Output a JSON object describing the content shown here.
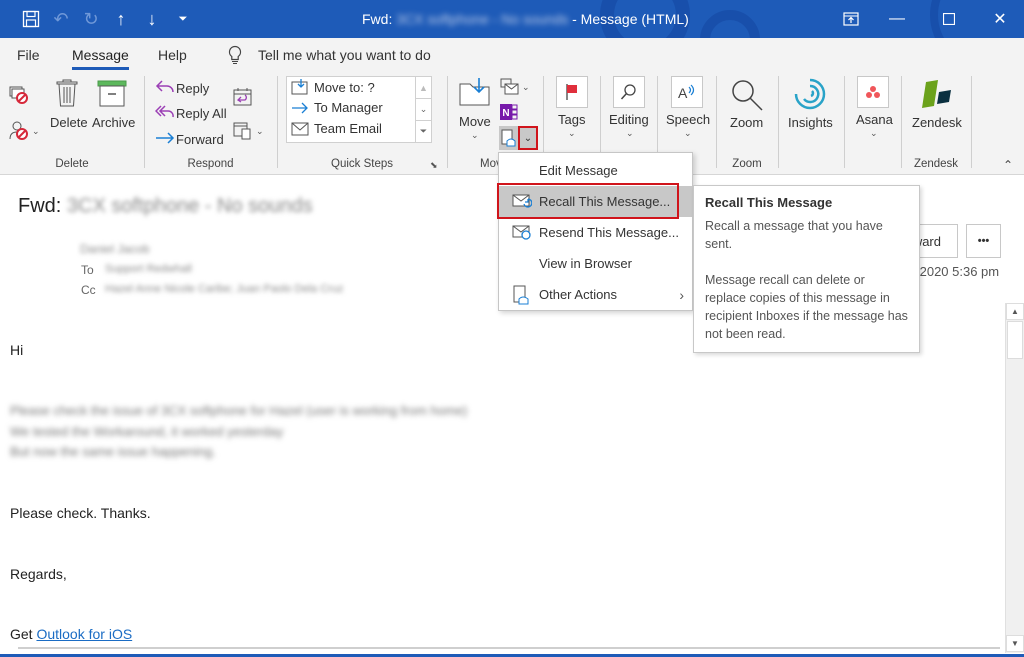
{
  "titlebar": {
    "subject_prefix": "Fwd:",
    "subject_blurred": "3CX softphone - No sounds",
    "suffix": "- Message (HTML)",
    "quick_access": [
      {
        "name": "save-icon",
        "glyph": "🖫"
      },
      {
        "name": "undo-icon",
        "glyph": "↶"
      },
      {
        "name": "redo-icon",
        "glyph": "↻"
      },
      {
        "name": "previous-item-icon",
        "glyph": "↑"
      },
      {
        "name": "next-item-icon",
        "glyph": "↓"
      },
      {
        "name": "customize-qat-icon",
        "glyph": "⏷"
      }
    ],
    "window_buttons": {
      "ribbon_display": "⊡",
      "minimize": "—",
      "maximize": "☐",
      "close": "✕"
    }
  },
  "tabs": {
    "file": "File",
    "message": "Message",
    "help": "Help",
    "tell_me": "Tell me what you want to do"
  },
  "ribbon": {
    "delete_group": {
      "label": "Delete",
      "delete": "Delete",
      "archive": "Archive"
    },
    "respond_group": {
      "label": "Respond",
      "reply": "Reply",
      "reply_all": "Reply All",
      "forward": "Forward"
    },
    "quick_steps_group": {
      "label": "Quick Steps",
      "items": [
        "Move to: ?",
        "To Manager",
        "Team Email"
      ]
    },
    "move_group": {
      "label": "Move",
      "move": "Move"
    },
    "tags": "Tags",
    "editing": "Editing",
    "speech": "Speech",
    "zoom_group": {
      "label": "Zoom",
      "zoom": "Zoom"
    },
    "insights": "Insights",
    "asana": "Asana",
    "zendesk_group": {
      "label": "Zendesk",
      "zendesk": "Zendesk"
    }
  },
  "header": {
    "subject_prefix": "Fwd:",
    "subject_blurred": "3CX softphone - No sounds",
    "from_blurred": "Daniel Jacob",
    "to_label": "To",
    "to_blurred": "Support Redwhall",
    "cc_label": "Cc",
    "cc_blurred": "Hazel Anne Nicole Caribe; Juan Paolo Dela Cruz",
    "forward_partial": "ward",
    "more_button": "•••",
    "date_partial": "/2020 5:36 pm"
  },
  "body": {
    "greeting": "Hi",
    "blurred_lines": [
      "Please check the issue of 3CX softphone for Hazel (user is working from home)",
      "We tested the Workaround,  it worked yesterday",
      "But now the same issue happening."
    ],
    "line_thanks": "Please check. Thanks.",
    "line_regards": "Regards,",
    "get_prefix": "Get ",
    "link_text": "Outlook for iOS"
  },
  "actions_menu": {
    "items": [
      {
        "label": "Edit Message",
        "mnemonic": "E",
        "icon": "none"
      },
      {
        "label": "Recall This Message...",
        "mnemonic": "T",
        "icon": "recall-message-icon",
        "highlighted": true
      },
      {
        "label": "Resend This Message...",
        "mnemonic": "s",
        "icon": "resend-message-icon"
      },
      {
        "label": "View in Browser",
        "mnemonic": "V",
        "icon": "none"
      },
      {
        "label": "Other Actions",
        "mnemonic": "O",
        "icon": "other-actions-icon",
        "submenu": true
      }
    ]
  },
  "tooltip": {
    "title": "Recall This Message",
    "para1": "Recall a message that you have sent.",
    "para2": "Message recall can delete or replace copies of this message in recipient Inboxes if the message has not been read."
  },
  "colors": {
    "titlebar": "#1e5bb8",
    "ribbon_bg": "#f3f3f3",
    "highlight_red": "#d0141b",
    "link": "#1a6cc4",
    "menu_highlight": "#c8c8c8"
  }
}
